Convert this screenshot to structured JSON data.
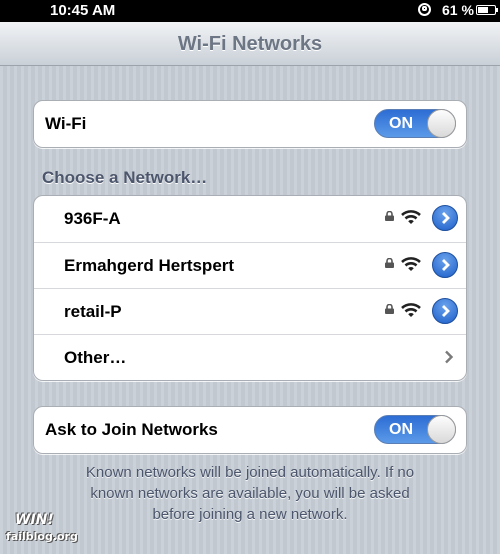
{
  "status_bar": {
    "time": "10:45 AM",
    "battery": "61 %",
    "battery_level": 0.61
  },
  "nav": {
    "title": "Wi-Fi Networks"
  },
  "wifi_cell": {
    "label": "Wi-Fi",
    "switch": "ON"
  },
  "networks_section": {
    "header": "Choose a Network…",
    "networks": [
      {
        "name": "936F-A"
      },
      {
        "name": "Ermahgerd Hertspert"
      },
      {
        "name": "retail-P"
      }
    ],
    "other": "Other…"
  },
  "ask_cell": {
    "label": "Ask to Join Networks",
    "switch": "ON"
  },
  "footer": {
    "lines": [
      "Known networks will be joined automatically. If no",
      "known networks are available, you will be asked",
      "before joining a new network."
    ]
  },
  "watermark": {
    "win": "WIN!",
    "site": "failblog.org"
  },
  "colors": {
    "accent": "#2d6dd4",
    "header_text": "#4c566c",
    "nav_title": "#6d7684"
  }
}
